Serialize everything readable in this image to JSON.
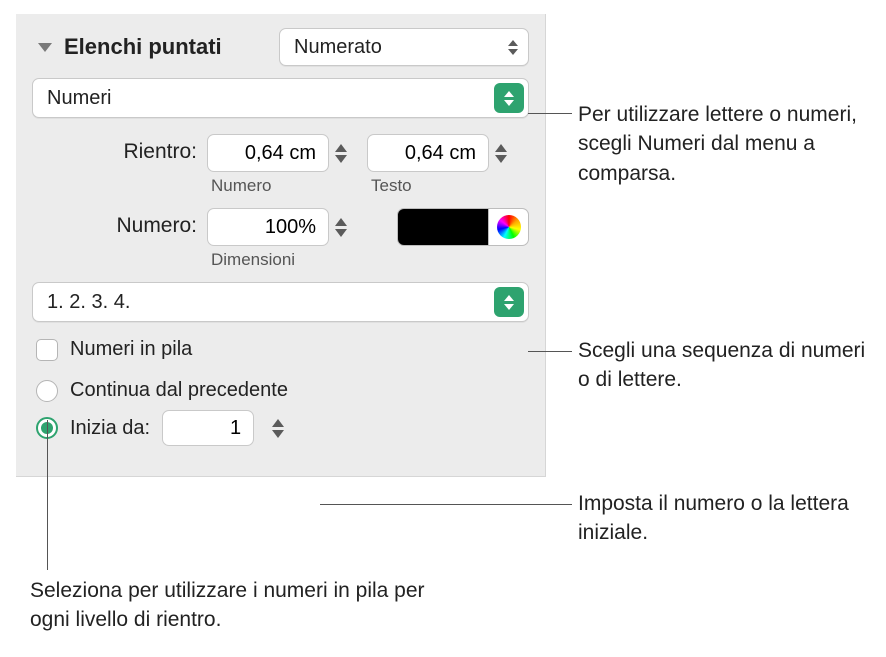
{
  "header": {
    "title": "Elenchi puntati",
    "style_menu": "Numerato"
  },
  "format_menu": "Numeri",
  "indent": {
    "label": "Rientro:",
    "number_value": "0,64 cm",
    "number_caption": "Numero",
    "text_value": "0,64 cm",
    "text_caption": "Testo"
  },
  "number": {
    "label": "Numero:",
    "size_value": "100%",
    "size_caption": "Dimensioni",
    "color": "#000000"
  },
  "sequence_menu": "1. 2. 3. 4.",
  "stacked": {
    "label": "Numeri in pila",
    "checked": false
  },
  "continuation": {
    "continue_label": "Continua dal precedente",
    "start_label": "Inizia da:",
    "start_value": "1",
    "selected": "start"
  },
  "callouts": {
    "format": "Per utilizzare lettere o numeri, scegli Numeri dal menu a comparsa.",
    "sequence": "Scegli una sequenza di numeri o di lettere.",
    "start": "Imposta il numero o la lettera iniziale.",
    "stacked": "Seleziona per utilizzare i numeri in pila per ogni livello di rientro."
  }
}
